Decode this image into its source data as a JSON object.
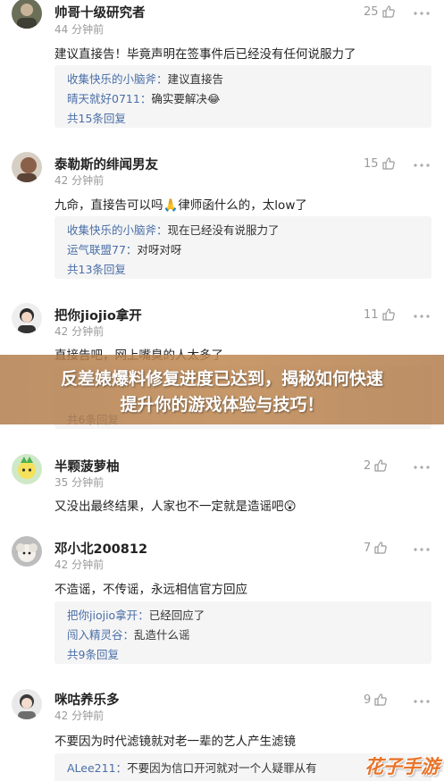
{
  "comments": [
    {
      "user": "帅哥十级研究者",
      "time": "44 分钟前",
      "likes": "25",
      "text": "建议直接告！毕竟声明在签事件后已经没有任何说服力了",
      "replies": [
        {
          "name": "收集快乐的小脑斧",
          "text": "建议直接告"
        },
        {
          "name": "晴天就好0711",
          "text": "确实要解决😂"
        }
      ],
      "more": "共15条回复"
    },
    {
      "user": "泰勒斯的绯闻男友",
      "time": "42 分钟前",
      "likes": "15",
      "text": "九命，直接告可以吗🙏律师函什么的，太low了",
      "replies": [
        {
          "name": "收集快乐的小脑斧",
          "text": "现在已经没有说服力了"
        },
        {
          "name": "运气联盟77",
          "text": "对呀对呀"
        }
      ],
      "more": "共13条回复"
    },
    {
      "user": "把你jiojio拿开",
      "time": "42 分钟前",
      "likes": "11",
      "text": "直接告吧，网上嘴臭的人太多了",
      "more": "共6条回复"
    },
    {
      "user": "半颗菠萝柚",
      "time": "35 分钟前",
      "likes": "2",
      "text": "又没出最终结果，人家也不一定就是造谣吧😲"
    },
    {
      "user": "邓小北200812",
      "time": "42 分钟前",
      "likes": "7",
      "text": "不造谣，不传谣，永远相信官方回应",
      "replies": [
        {
          "name": "把你jiojio拿开",
          "text": "已经回应了"
        },
        {
          "name": "闯入精灵谷",
          "text": "乱造什么谣"
        }
      ],
      "more": "共9条回复"
    },
    {
      "user": "咪咕养乐多",
      "time": "42 分钟前",
      "likes": "9",
      "text": "不要因为时代滤镜就对老一辈的艺人产生滤镜",
      "replies": [
        {
          "name": "ALee211",
          "text": "不要因为信口开河就对一个人疑罪从有"
        }
      ]
    }
  ],
  "banner": {
    "line1": "反差婊爆料修复进度已达到，揭秘如何快速",
    "line2": "提升你的游戏体验与技巧！"
  },
  "watermark": "花子手游",
  "colors": {
    "reply_name": "#4a6fa8",
    "banner": "#b4784a",
    "watermark": "#e8742a"
  },
  "icons": [
    "thumbs-up-icon",
    "more-icon"
  ]
}
